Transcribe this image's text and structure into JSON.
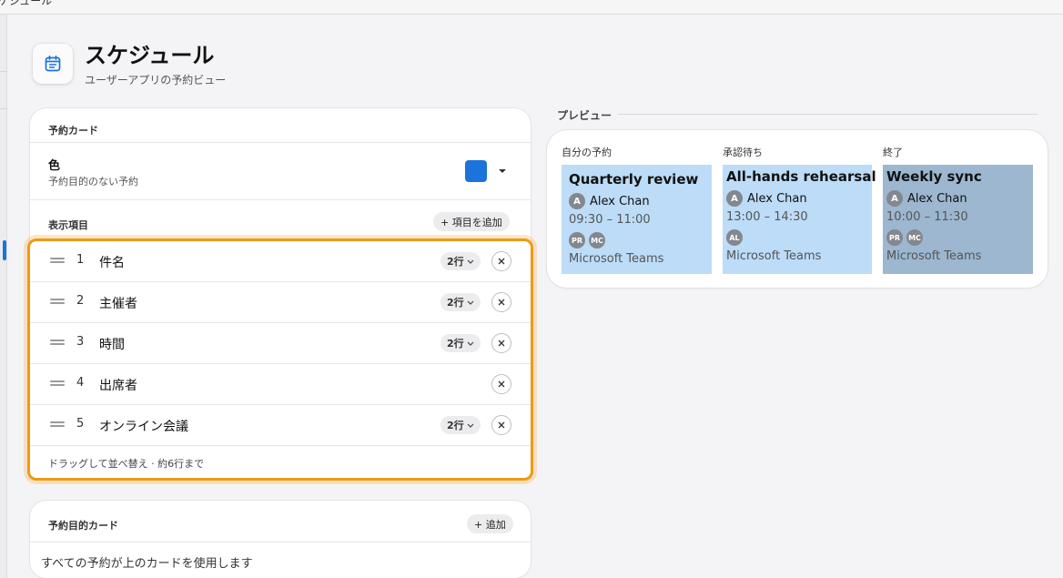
{
  "window": {
    "title": "スケジュール"
  },
  "header": {
    "title": "スケジュール",
    "subtitle": "ユーザーアプリの予約ビュー",
    "icon": "calendar-icon"
  },
  "booking_card": {
    "section_title": "予約カード",
    "color": {
      "label": "色",
      "description": "予約目的のない予約",
      "value": "#1a74d9"
    },
    "display_items": {
      "section_title": "表示項目",
      "add_button": "+ 項目を追加",
      "items": [
        {
          "number": "1",
          "name": "件名",
          "lines": "2行"
        },
        {
          "number": "2",
          "name": "主催者",
          "lines": "2行"
        },
        {
          "number": "3",
          "name": "時間",
          "lines": "2行"
        },
        {
          "number": "4",
          "name": "出席者",
          "lines": ""
        },
        {
          "number": "5",
          "name": "オンライン会議",
          "lines": "2行"
        }
      ],
      "hint": "ドラッグして並べ替え · 約6行まで"
    }
  },
  "purpose_card": {
    "section_title": "予約目的カード",
    "add_button": "+ 追加",
    "note": "すべての予約が上のカードを使用します"
  },
  "preview": {
    "label": "プレビュー",
    "columns": [
      {
        "heading": "自分の予約",
        "background": "#bcdcf7",
        "event": {
          "title": "Quarterly review",
          "organizer": "Alex Chan",
          "organizer_initial": "A",
          "time": "09:30 – 11:00",
          "attendees": [
            "PR",
            "MC"
          ],
          "location": "Microsoft Teams"
        }
      },
      {
        "heading": "承認待ち",
        "background": "#bcdcf7",
        "event": {
          "title": "All-hands rehearsal",
          "organizer": "Alex Chan",
          "organizer_initial": "A",
          "time": "13:00 – 14:30",
          "attendees": [
            "AL"
          ],
          "location": "Microsoft Teams"
        }
      },
      {
        "heading": "終了",
        "background": "#9cb7cf",
        "event": {
          "title": "Weekly sync",
          "organizer": "Alex Chan",
          "organizer_initial": "A",
          "time": "10:00 – 11:30",
          "attendees": [
            "PR",
            "MC"
          ],
          "location": "Microsoft Teams"
        }
      }
    ]
  }
}
